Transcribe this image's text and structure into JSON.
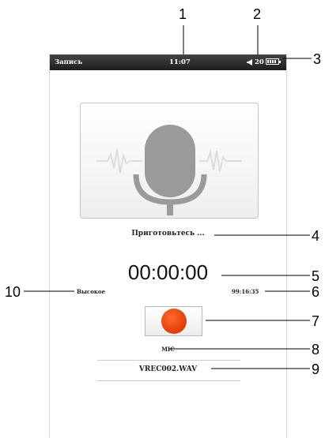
{
  "status_bar": {
    "title": "Запись",
    "time": "11:07",
    "volume": "20"
  },
  "recorder": {
    "status_text": "Приготовьтесь ...",
    "timer": "00:00:00",
    "quality": "Высокое",
    "remaining": "99:16:35",
    "source": "MIC",
    "filename": "VREC002.WAV"
  },
  "icons": {
    "microphone": "microphone-icon",
    "volume": "speaker-icon",
    "battery": "battery-icon",
    "record": "record-icon"
  },
  "colors": {
    "status_bar": "#2c2c2c",
    "record": "#f04a0d",
    "mic": "#999999"
  },
  "callouts": [
    "1",
    "2",
    "3",
    "4",
    "5",
    "6",
    "7",
    "8",
    "9",
    "10"
  ]
}
